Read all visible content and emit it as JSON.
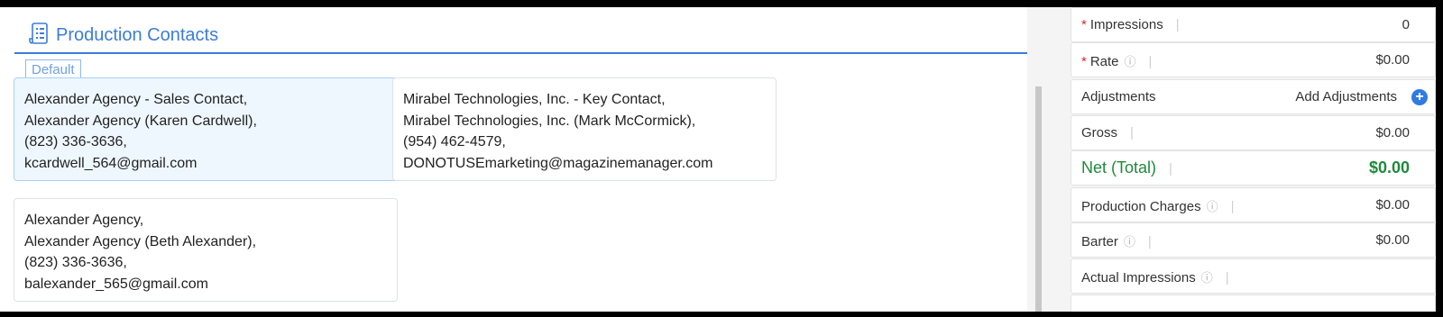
{
  "production": {
    "title": "Production Contacts",
    "default_tab": "Default",
    "contacts": [
      {
        "line1": "Alexander Agency - Sales Contact,",
        "line2": "Alexander Agency (Karen Cardwell),",
        "line3": "(823) 336-3636,",
        "line4": "kcardwell_564@gmail.com"
      },
      {
        "line1": "Mirabel Technologies, Inc. - Key Contact,",
        "line2": "Mirabel Technologies, Inc. (Mark McCormick),",
        "line3": "(954) 462-4579,",
        "line4": "DONOTUSEmarketing@magazinemanager.com"
      },
      {
        "line1": "Alexander Agency,",
        "line2": "Alexander Agency (Beth Alexander),",
        "line3": "(823) 336-3636,",
        "line4": "balexander_565@gmail.com"
      }
    ]
  },
  "summary": {
    "required_mark": "*",
    "separator": "|",
    "info_glyph": "ⓘ",
    "impressions": {
      "label": "Impressions",
      "value": "0"
    },
    "rate": {
      "label": "Rate",
      "value": "$0.00"
    },
    "adjustments": {
      "label": "Adjustments",
      "action": "Add Adjustments",
      "action_icon": "+"
    },
    "gross": {
      "label": "Gross",
      "value": "$0.00"
    },
    "net": {
      "label": "Net (Total)",
      "value": "$0.00"
    },
    "production_charges": {
      "label": "Production Charges",
      "value": "$0.00"
    },
    "barter": {
      "label": "Barter",
      "value": "$0.00"
    },
    "actual_impressions": {
      "label": "Actual Impressions",
      "value": ""
    }
  },
  "colors": {
    "accent": "#3b7dd8",
    "net_total": "#1e8a3a",
    "required": "#d9272e"
  }
}
